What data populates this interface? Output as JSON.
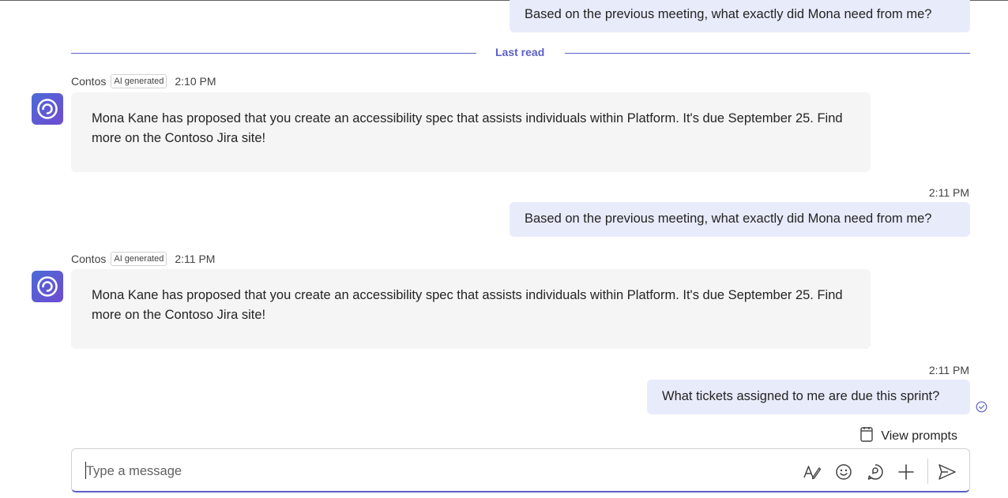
{
  "messages": [
    {
      "type": "out",
      "text": "Based on the previous meeting, what exactly did Mona need from me?"
    },
    {
      "type": "in",
      "sender": "Contos",
      "badge": "AI generated",
      "time": "2:10 PM",
      "text": "Mona Kane has proposed that you create an accessibility spec that assists individuals within Platform. It's due September 25. Find more on the Contoso Jira site!"
    },
    {
      "type": "out",
      "time": "2:11 PM",
      "text": "Based on the previous meeting, what exactly did Mona need from me?"
    },
    {
      "type": "in",
      "sender": "Contos",
      "badge": "AI generated",
      "time": "2:11 PM",
      "text": "Mona Kane has proposed that you create an accessibility spec that assists individuals within Platform. It's due September 25. Find more on the Contoso Jira site!"
    },
    {
      "type": "out",
      "time": "2:11 PM",
      "text": "What tickets assigned to me are due this sprint?"
    }
  ],
  "divider": {
    "label": "Last read"
  },
  "view_prompts": {
    "label": "View prompts"
  },
  "composer": {
    "placeholder": "Type a message"
  },
  "icons": {
    "avatar": "copilot-logo-icon",
    "format": "format-text-icon",
    "emoji": "emoji-icon",
    "loop": "loop-icon",
    "add": "plus-icon",
    "send": "send-icon",
    "seen": "read-receipt-icon",
    "prompts": "notepad-icon"
  },
  "colors": {
    "accent": "#5b5fc7",
    "outgoing_bubble": "#e8ebfa",
    "incoming_bubble": "#f5f5f5"
  }
}
